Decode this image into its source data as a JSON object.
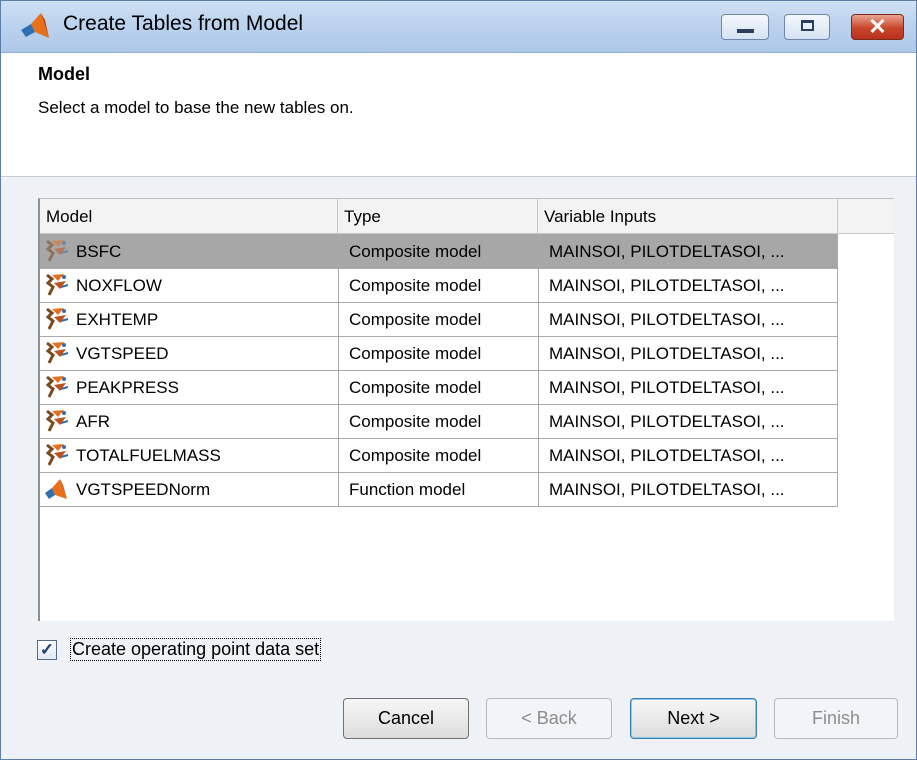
{
  "window": {
    "title": "Create Tables from Model"
  },
  "header": {
    "section_title": "Model",
    "description": "Select a model to base the new tables on."
  },
  "table": {
    "columns": [
      "Model",
      "Type",
      "Variable Inputs"
    ],
    "rows": [
      {
        "model": "BSFC",
        "type": "Composite model",
        "inputs": "MAINSOI, PILOTDELTASOI, ...",
        "icon": "composite-model-icon",
        "selected": true
      },
      {
        "model": "NOXFLOW",
        "type": "Composite model",
        "inputs": "MAINSOI, PILOTDELTASOI, ...",
        "icon": "composite-model-icon"
      },
      {
        "model": "EXHTEMP",
        "type": "Composite model",
        "inputs": "MAINSOI, PILOTDELTASOI, ...",
        "icon": "composite-model-icon"
      },
      {
        "model": "VGTSPEED",
        "type": "Composite model",
        "inputs": "MAINSOI, PILOTDELTASOI, ...",
        "icon": "composite-model-icon"
      },
      {
        "model": "PEAKPRESS",
        "type": "Composite model",
        "inputs": "MAINSOI, PILOTDELTASOI, ...",
        "icon": "composite-model-icon"
      },
      {
        "model": "AFR",
        "type": "Composite model",
        "inputs": "MAINSOI, PILOTDELTASOI, ...",
        "icon": "composite-model-icon"
      },
      {
        "model": "TOTALFUELMASS",
        "type": "Composite model",
        "inputs": "MAINSOI, PILOTDELTASOI, ...",
        "icon": "composite-model-icon"
      },
      {
        "model": "VGTSPEEDNorm",
        "type": "Function model",
        "inputs": "MAINSOI, PILOTDELTASOI, ...",
        "icon": "function-model-icon"
      }
    ]
  },
  "options": {
    "create_op_data_set_label": "Create operating point data set",
    "create_op_data_set_checked": true
  },
  "buttons": {
    "cancel": "Cancel",
    "back": "< Back",
    "next": "Next >",
    "finish": "Finish"
  },
  "colors": {
    "selected_row": "#a7a7a7",
    "titlebar": "#bcd3ee",
    "close_button": "#c8452b"
  }
}
